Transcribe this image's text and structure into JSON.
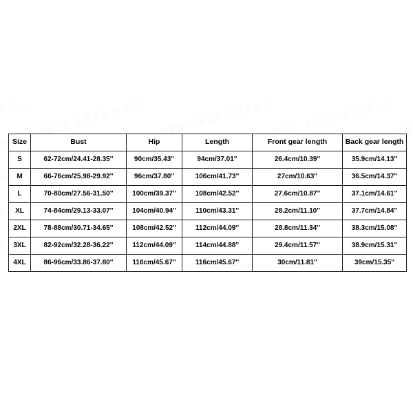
{
  "page": {
    "background_color": "#ffffff",
    "border_color": "#1a1a1a",
    "text_color": "#000000",
    "watermark_text": "6929"
  },
  "table": {
    "name": "size-chart",
    "columns": [
      "Size",
      "Bust",
      "Hip",
      "Length",
      "Front gear length",
      "Back gear length"
    ],
    "rows": [
      {
        "size": "S",
        "bust": "62-72cm/24.41-28.35''",
        "hip": "90cm/35.43''",
        "length": "94cm/37.01''",
        "front_gear_length": "26.4cm/10.39''",
        "back_gear_length": "35.9cm/14.13''"
      },
      {
        "size": "M",
        "bust": "66-76cm/25.98-29.92''",
        "hip": "96cm/37.80''",
        "length": "106cm/41.73''",
        "front_gear_length": "27cm/10.63''",
        "back_gear_length": "36.5cm/14.37''"
      },
      {
        "size": "L",
        "bust": "70-80cm/27.56-31.50''",
        "hip": "100cm/39.37''",
        "length": "108cm/42.52''",
        "front_gear_length": "27.6cm/10.87''",
        "back_gear_length": "37.1cm/14.61''"
      },
      {
        "size": "XL",
        "bust": "74-84cm/29.13-33.07''",
        "hip": "104cm/40.94''",
        "length": "110cm/43.31''",
        "front_gear_length": "28.2cm/11.10''",
        "back_gear_length": "37.7cm/14.84''"
      },
      {
        "size": "2XL",
        "bust": "78-88cm/30.71-34.65''",
        "hip": "108cm/42.52''",
        "length": "112cm/44.09''",
        "front_gear_length": "28.8cm/11.34''",
        "back_gear_length": "38.3cm/15.08''"
      },
      {
        "size": "3XL",
        "bust": "82-92cm/32.28-36.22''",
        "hip": "112cm/44.09''",
        "length": "114cm/44.88''",
        "front_gear_length": "29.4cm/11.57''",
        "back_gear_length": "38.9cm/15.31''"
      },
      {
        "size": "4XL",
        "bust": "86-96cm/33.86-37.80''",
        "hip": "116cm/45.67''",
        "length": "116cm/45.67''",
        "front_gear_length": "30cm/11.81''",
        "back_gear_length": "39cm/15.35''"
      }
    ]
  }
}
